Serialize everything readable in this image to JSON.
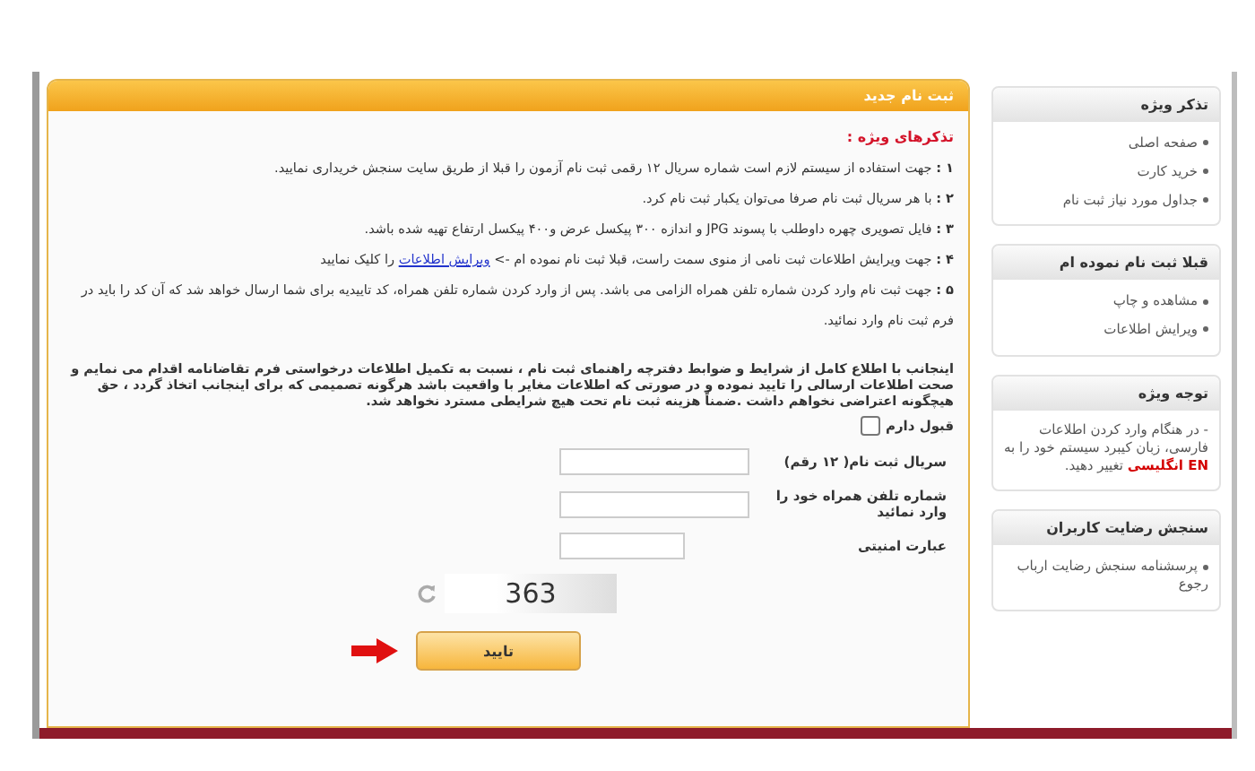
{
  "main": {
    "title": "ثبت نام جدید",
    "notes_title": "تذکرهای ویژه :",
    "notes": [
      {
        "number": "۱ :",
        "text": "جهت استفاده از سیستم لازم است شماره سریال ۱۲ رقمی ثبت نام آزمون را قبلا از طریق سایت سنجش خریداری نمایید."
      },
      {
        "number": "۲ :",
        "text": "با هر سریال ثبت نام صرفا می‌توان یکبار ثبت نام کرد."
      },
      {
        "number": "۳ :",
        "text": "فایل تصویری چهره داوطلب با پسوند JPG و اندازه ۳۰۰ پیکسل عرض و۴۰۰ پیکسل ارتفاع تهیه شده باشد."
      },
      {
        "number": "۴ :",
        "text": "جهت ویرایش اطلاعات ثبت نامی از منوی سمت راست، قبلا ثبت نام نموده ام ->",
        "link": "ویرایش اطلاعات",
        "after": "را کلیک نمایید"
      },
      {
        "number": "۵ :",
        "text": "جهت ثبت نام وارد کردن شماره تلفن همراه الزامی می باشد. پس از وارد کردن شماره تلفن همراه، کد تاییدیه برای شما ارسال خواهد شد که آن کد را باید در فرم ثبت نام وارد نمائید."
      }
    ],
    "agreement": "اینجانب با اطلاع کامل از شرایط و ضوابط دفترچه راهنمای ثبت نام ، نسبت به تکمیل اطلاعات درخواستی فرم تقاضانامه اقدام می نمایم و صحت اطلاعات ارسالی را تایید نموده و در صورتی که اطلاعات مغایر با واقعیت باشد هرگونه تصمیمی که برای اینجانب اتخاذ گردد ، حق هیچگونه اعتراضی نخواهم داشت .ضمناً هزینه ثبت نام تحت هیچ شرایطی مسترد نخواهد شد.",
    "accept": {
      "label": "قبول دارم",
      "checked": false
    },
    "fields": [
      {
        "label": "سریال ثبت نام( ۱۲ رقم)",
        "kind": "wide"
      },
      {
        "label": "شماره تلفن همراه خود را وارد نمائید",
        "kind": "wide"
      },
      {
        "label": "عبارت امنیتی",
        "kind": "short"
      }
    ],
    "captcha": "363",
    "submit": "تایید"
  },
  "sidebar": [
    {
      "title": "تذکر ویژه",
      "kind": "list",
      "items": [
        "صفحه اصلی",
        "خرید کارت",
        "جداول مورد نیاز ثبت نام"
      ]
    },
    {
      "title": "قبلا ثبت نام نموده ام",
      "kind": "list",
      "items": [
        "مشاهده و چاپ",
        "ویرایش اطلاعات"
      ]
    },
    {
      "title": "توجه ویژه",
      "kind": "note",
      "text": "- در هنگام وارد کردن اطلاعات فارسی، زبان کیبرد سیستم خود را به **EN انگلیسی** تغییر دهید."
    },
    {
      "title": "سنجش رضایت کاربران",
      "kind": "list",
      "items": [
        "پرسشنامه سنجش رضایت ارباب رجوع"
      ]
    }
  ]
}
